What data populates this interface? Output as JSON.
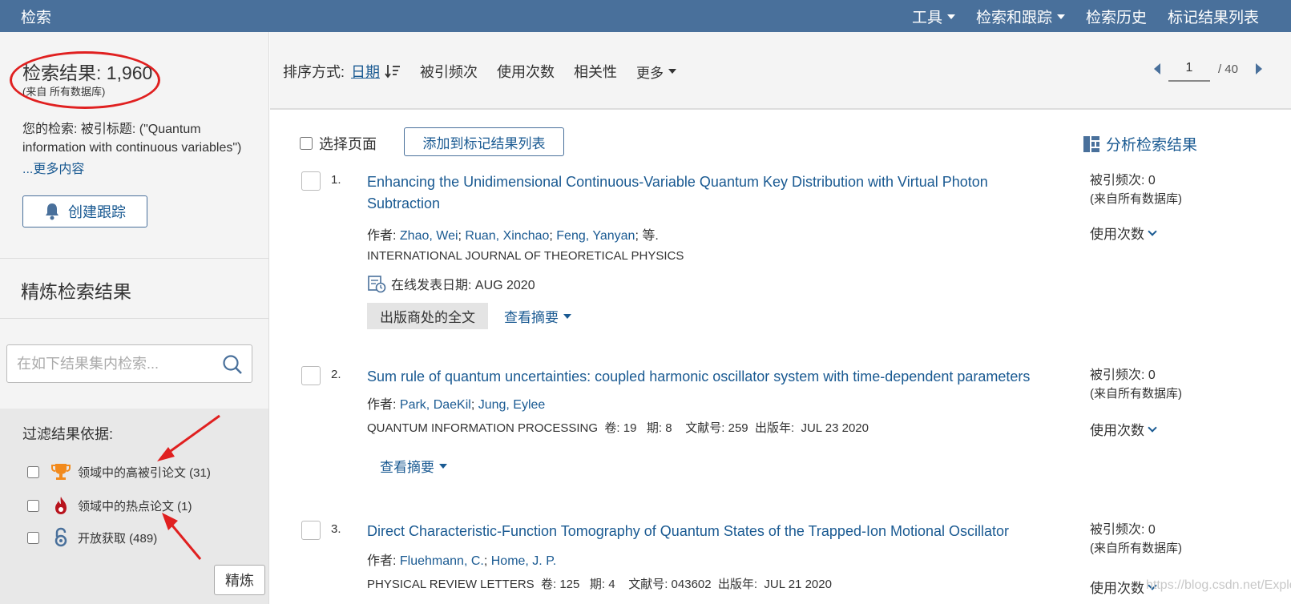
{
  "topbar": {
    "title": "检索",
    "nav": [
      "工具",
      "检索和跟踪",
      "检索历史",
      "标记结果列表"
    ]
  },
  "sidebar": {
    "result_count_label": "检索结果: 1,960",
    "result_source": "(来自 所有数据库)",
    "your_search": "您的检索: 被引标题: (\"Quantum information with continuous variables\")",
    "more_link": "...更多内容",
    "create_alert": "创建跟踪",
    "refine_title": "精炼检索结果",
    "search_placeholder": "在如下结果集内检索...",
    "filter_title": "过滤结果依据:",
    "filters": [
      {
        "label": "领域中的高被引论文 (31)",
        "icon": "trophy-icon"
      },
      {
        "label": "领域中的热点论文 (1)",
        "icon": "fire-icon"
      },
      {
        "label": "开放获取 (489)",
        "icon": "open-access-icon"
      }
    ],
    "refine_button": "精炼"
  },
  "sortbar": {
    "label": "排序方式:",
    "active": "日期",
    "options": [
      "被引频次",
      "使用次数",
      "相关性"
    ],
    "more": "更多",
    "page_current": "1",
    "page_total": "/ 40"
  },
  "toolbar": {
    "select_page": "选择页面",
    "add_to_marked": "添加到标记结果列表",
    "analyze": "分析检索结果"
  },
  "records": [
    {
      "num": "1.",
      "title": "Enhancing the Unidimensional Continuous-Variable Quantum Key Distribution with Virtual Photon Subtraction",
      "author_prefix": "作者:",
      "authors": [
        "Zhao, Wei",
        "Ruan, Xinchao",
        "Feng, Yanyan"
      ],
      "author_suffix": "等.",
      "journal": "INTERNATIONAL JOURNAL OF THEORETICAL PHYSICS",
      "online_date": "在线发表日期: AUG 2020",
      "fulltext": "出版商处的全文",
      "abstract": "查看摘要",
      "cited": "被引频次: 0",
      "cited_source": "(来自所有数据库)",
      "usage": "使用次数"
    },
    {
      "num": "2.",
      "title": "Sum rule of quantum uncertainties: coupled harmonic oscillator system with time-dependent parameters",
      "author_prefix": "作者:",
      "authors": [
        "Park, DaeKil",
        "Jung, Eylee"
      ],
      "journal_line": "QUANTUM INFORMATION PROCESSING  卷: 19   期: 8    文献号: 259  出版年:  JUL 23 2020",
      "abstract": "查看摘要",
      "cited": "被引频次: 0",
      "cited_source": "(来自所有数据库)",
      "usage": "使用次数"
    },
    {
      "num": "3.",
      "title": "Direct Characteristic-Function Tomography of Quantum States of the Trapped-Ion Motional Oscillator",
      "author_prefix": "作者:",
      "authors": [
        "Fluehmann, C.",
        "Home, J. P."
      ],
      "journal_line": "PHYSICAL REVIEW LETTERS  卷: 125   期: 4    文献号: 043602  出版年:  JUL 21 2020",
      "cited": "被引频次: 0",
      "cited_source": "(来自所有数据库)",
      "usage": "使用次数"
    }
  ],
  "watermark": "https://blog.csdn.net/Explore_OuO",
  "colors": {
    "topbar": "#49709b",
    "link": "#1a5a92",
    "annotation": "#e02020"
  }
}
